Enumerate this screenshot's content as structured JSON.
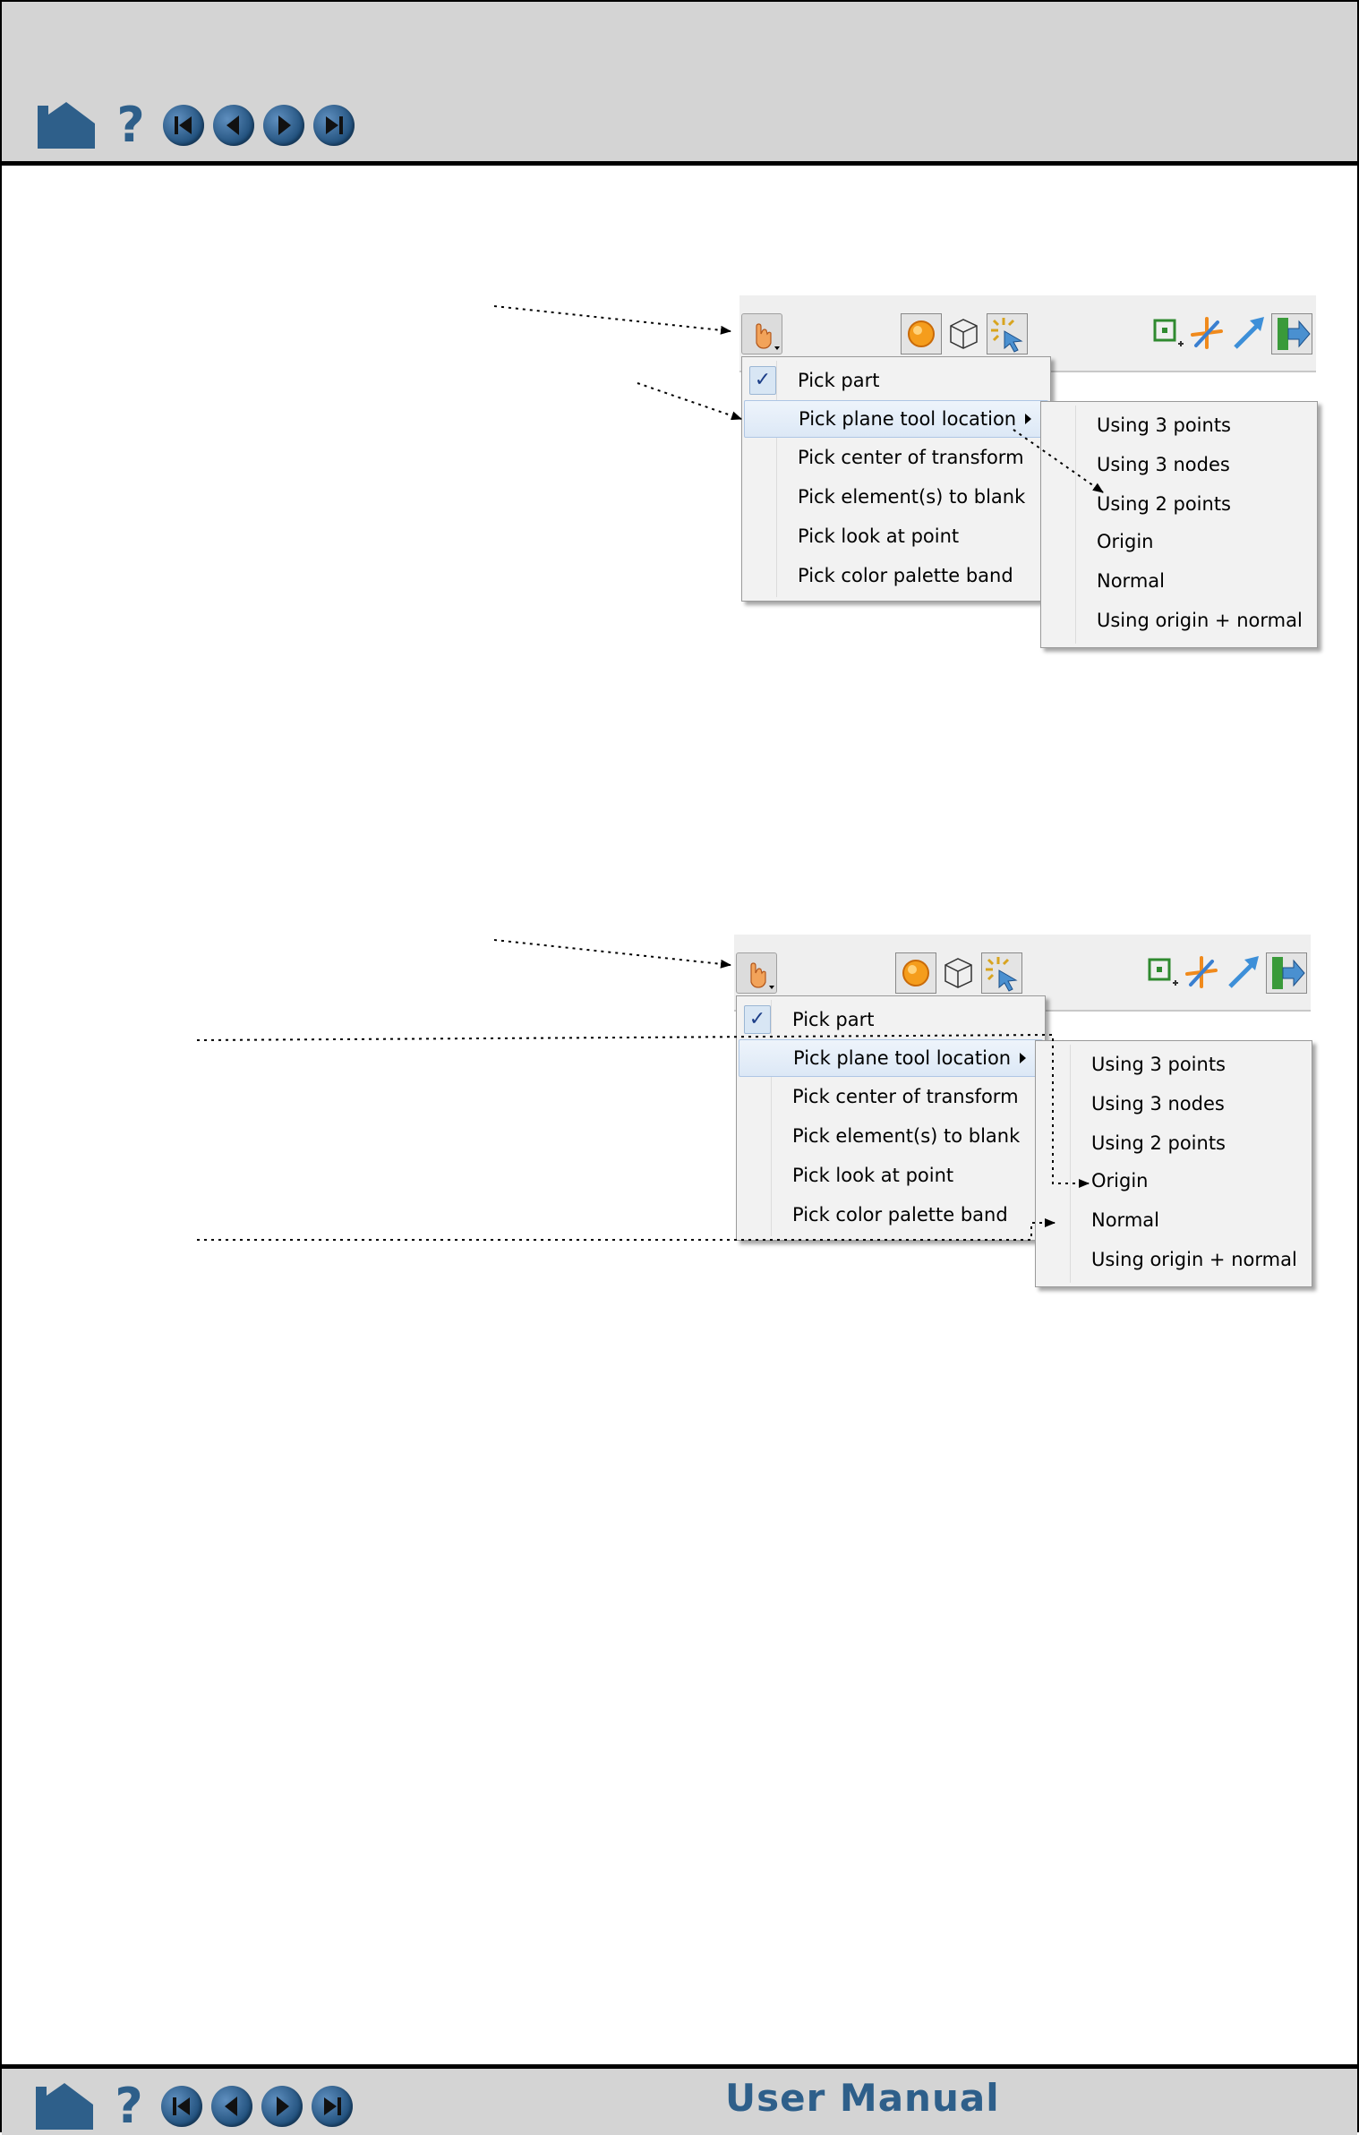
{
  "footer": {
    "title": "User Manual"
  },
  "nav": {
    "home_icon": "home-icon",
    "help_icon": "help-icon",
    "first_icon": "first-page-icon",
    "prev_icon": "previous-page-icon",
    "next_icon": "next-page-icon",
    "last_icon": "last-page-icon",
    "help_glyph": "?"
  },
  "pick_menu": {
    "check_mark": "✓",
    "items": [
      "Pick part",
      "Pick plane tool location",
      "Pick center of transform",
      "Pick element(s) to blank",
      "Pick look at point",
      "Pick color palette band"
    ],
    "checked_item": "Pick part",
    "highlighted_item": "Pick plane tool location"
  },
  "plane_submenu": {
    "items": [
      "Using 3 points",
      "Using 3 nodes",
      "Using 2 points",
      "Origin",
      "Normal",
      "Using origin + normal"
    ]
  },
  "colors": {
    "band": "#d4d4d4",
    "nav_blue": "#2e5f8a",
    "highlight": "#dce8f6"
  }
}
